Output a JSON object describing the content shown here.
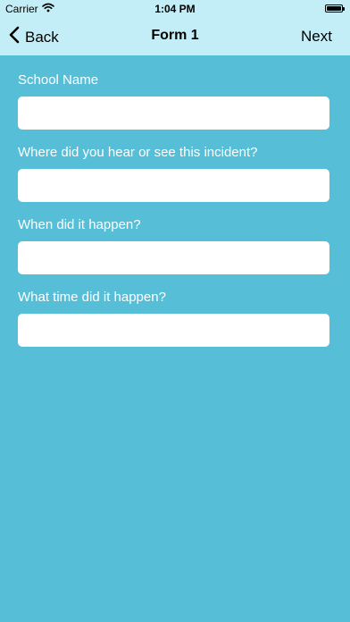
{
  "status_bar": {
    "carrier": "Carrier",
    "time": "1:04 PM",
    "battery_level": 1.0
  },
  "nav": {
    "back_label": "Back",
    "title": "Form 1",
    "next_label": "Next"
  },
  "form": {
    "fields": [
      {
        "label": "School Name",
        "value": "",
        "placeholder": ""
      },
      {
        "label": "Where did you hear or see this incident?",
        "value": "",
        "placeholder": ""
      },
      {
        "label": "When did it happen?",
        "value": "",
        "placeholder": ""
      },
      {
        "label": "What time did it happen?",
        "value": "",
        "placeholder": ""
      }
    ]
  },
  "colors": {
    "background": "#56BED7",
    "bar_background": "#C4EEF7",
    "label_text": "#FFFFFF",
    "input_background": "#FFFFFF"
  },
  "icons": {
    "wifi": "wifi-icon",
    "battery": "battery-icon",
    "back": "chevron-left-icon"
  }
}
